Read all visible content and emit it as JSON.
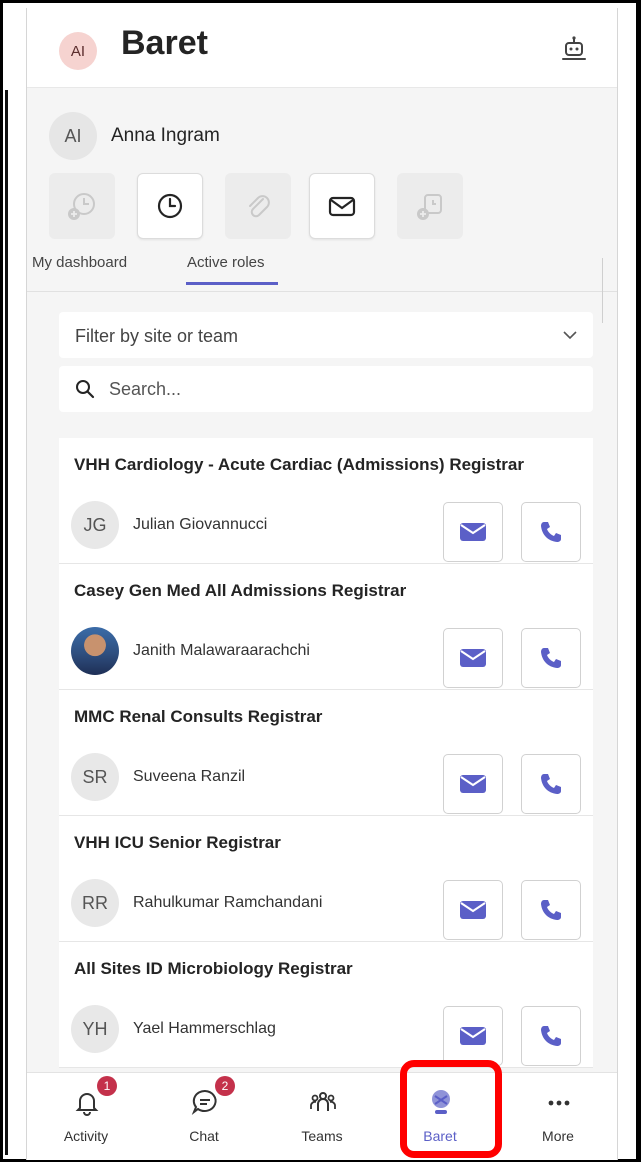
{
  "header": {
    "avatar_initials": "AI",
    "app_title": "Baret",
    "bot_icon": "bot-icon"
  },
  "user": {
    "initials": "AI",
    "name": "Anna Ingram"
  },
  "tiles": [
    {
      "icon": "clock-add-icon",
      "active": false
    },
    {
      "icon": "clock-icon",
      "active": true
    },
    {
      "icon": "paperclip-icon",
      "active": false
    },
    {
      "icon": "mail-icon",
      "active": true
    },
    {
      "icon": "clock-add-icon",
      "active": false
    }
  ],
  "tabs": [
    {
      "label": "My dashboard",
      "selected": false
    },
    {
      "label": "Active roles",
      "selected": true
    }
  ],
  "filter": {
    "placeholder": "Filter by site or team",
    "icon": "chevron-down-icon"
  },
  "search": {
    "placeholder": "Search...",
    "icon": "search-icon"
  },
  "roles": [
    {
      "role": "VHH Cardiology - Acute Cardiac (Admissions) Registrar",
      "initials": "JG",
      "person": "Julian Giovannucci",
      "photo": false
    },
    {
      "role": "Casey Gen Med All Admissions Registrar",
      "initials": "",
      "person": "Janith Malawaraarachchi",
      "photo": true
    },
    {
      "role": "MMC Renal Consults Registrar",
      "initials": "SR",
      "person": "Suveena Ranzil",
      "photo": false
    },
    {
      "role": "VHH ICU Senior Registrar",
      "initials": "RR",
      "person": "Rahulkumar Ramchandani",
      "photo": false
    },
    {
      "role": "All Sites ID Microbiology Registrar",
      "initials": "YH",
      "person": "Yael Hammerschlag",
      "photo": false
    }
  ],
  "bottom_nav": [
    {
      "label": "Activity",
      "icon": "bell-icon",
      "badge": "1"
    },
    {
      "label": "Chat",
      "icon": "chat-icon",
      "badge": "2"
    },
    {
      "label": "Teams",
      "icon": "teams-icon",
      "badge": ""
    },
    {
      "label": "Baret",
      "icon": "baret-icon",
      "badge": ""
    },
    {
      "label": "More",
      "icon": "more-icon",
      "badge": ""
    }
  ],
  "colors": {
    "accent": "#5b5fc7",
    "badge": "#c4314b",
    "highlight": "#ff0000"
  }
}
